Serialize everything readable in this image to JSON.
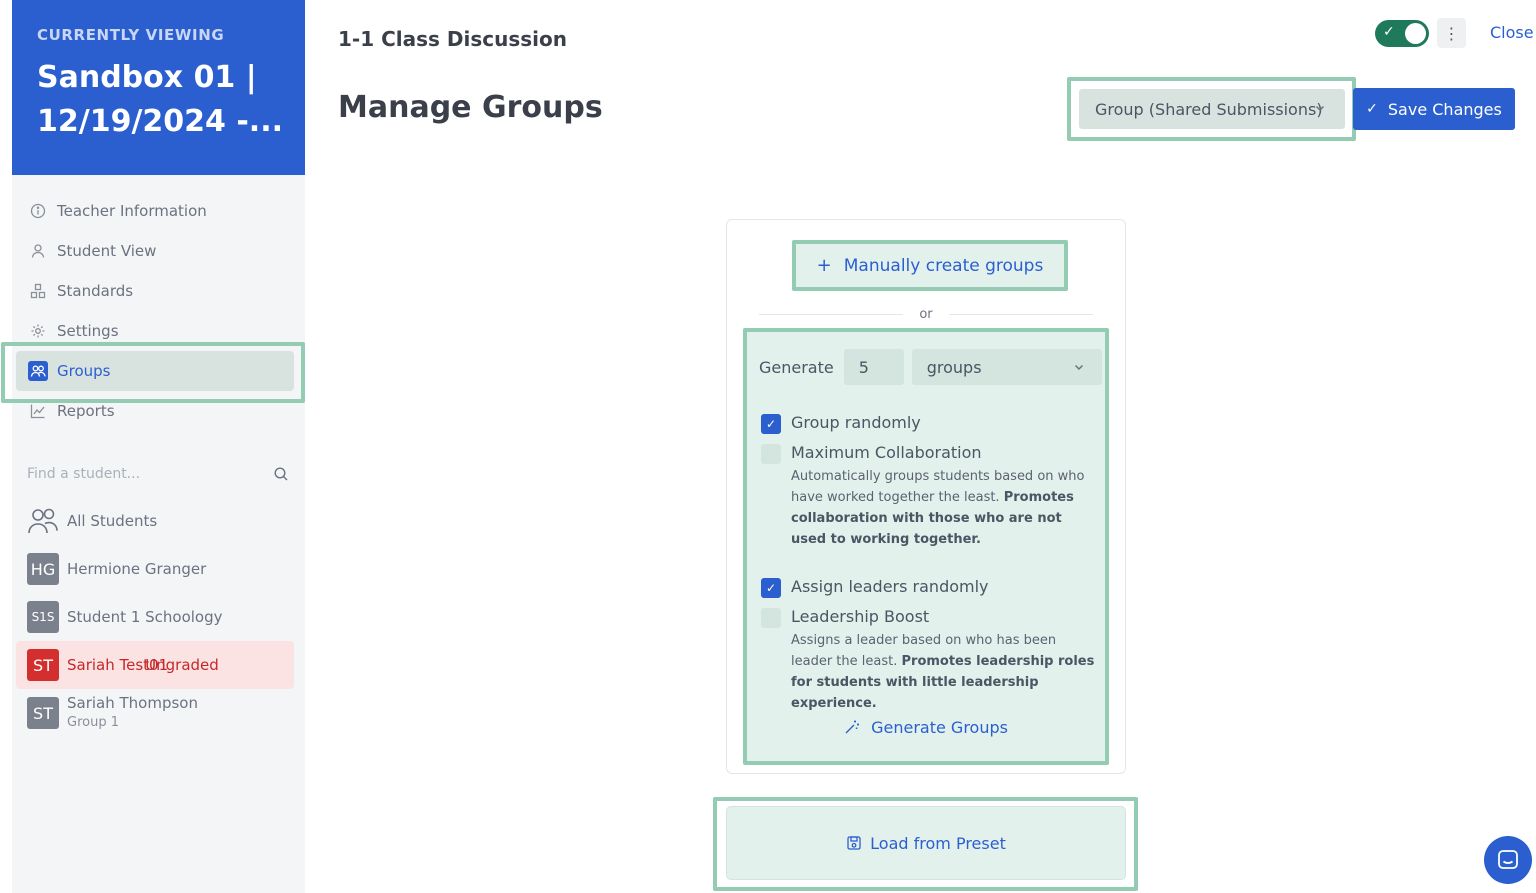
{
  "sidebar": {
    "eyebrow": "CURRENTLY VIEWING",
    "assignment": "Sandbox 01 | 12/19/2024 -...",
    "nav": [
      {
        "label": "Teacher Information",
        "icon": "info-icon"
      },
      {
        "label": "Student View",
        "icon": "person-icon"
      },
      {
        "label": "Standards",
        "icon": "standards-icon"
      },
      {
        "label": "Settings",
        "icon": "gear-icon"
      },
      {
        "label": "Groups",
        "icon": "groups-icon",
        "active": true
      },
      {
        "label": "Reports",
        "icon": "chart-icon"
      }
    ],
    "search_placeholder": "Find a student...",
    "students": [
      {
        "initials": "",
        "name": "All Students"
      },
      {
        "initials": "HG",
        "name": "Hermione Granger"
      },
      {
        "initials": "S1S",
        "name": "Student 1 Schoology"
      },
      {
        "initials": "ST",
        "name": "Sariah Test01",
        "badge": "Ungraded"
      },
      {
        "initials": "ST",
        "name": "Sariah Thompson",
        "sub": "Group 1"
      }
    ]
  },
  "header": {
    "assignment_title": "1-1 Class Discussion",
    "page_title": "Manage Groups",
    "toggle_on": true,
    "more_label": "⋮",
    "close_label": "Close",
    "mode_select": "Group (Shared Submissions)",
    "save_label": "Save Changes"
  },
  "manager": {
    "manual_label": "Manually create groups",
    "or_label": "or",
    "generate_label": "Generate",
    "count_value": "5",
    "unit_value": "groups",
    "options": [
      {
        "title": "Group randomly",
        "checked": true,
        "desc": ""
      },
      {
        "title": "Maximum Collaboration",
        "checked": false,
        "desc": "Automatically groups students based on who have worked together the least.",
        "desc_bold": "Promotes collaboration with those who are not used to working together."
      },
      {
        "title": "Assign leaders randomly",
        "checked": true,
        "desc": ""
      },
      {
        "title": "Leadership Boost",
        "checked": false,
        "desc": "Assigns a leader based on who has been leader the least.",
        "desc_bold": "Promotes leadership roles for students with little leadership experience."
      }
    ],
    "generate_button": "Generate Groups",
    "preset_label": "Load from Preset"
  },
  "colors": {
    "primary": "#2b5fd0",
    "highlight": "#93cbb3",
    "panel": "#e3f1ec",
    "toggle": "#1f7a5c",
    "danger": "#c62828"
  }
}
